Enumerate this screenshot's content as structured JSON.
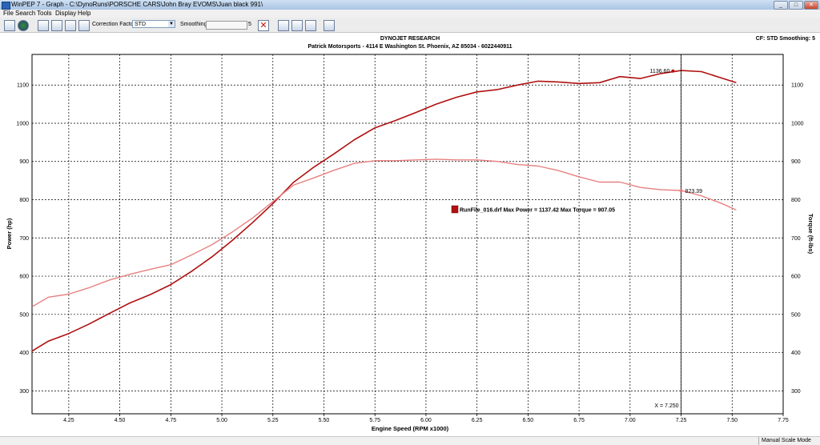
{
  "window": {
    "title": "WinPEP 7 - Graph - C:\\DynoRuns\\PORSCHE CARS\\John Bray EVOMS\\Juan black 991\\",
    "buttons": [
      "_",
      "□",
      "✕"
    ]
  },
  "menu": [
    "File",
    "Search",
    "Tools",
    "Display",
    "Help"
  ],
  "toolbar": {
    "correction_label": "Correction Factor:",
    "correction_value": "STD",
    "smoothing_label": "Smoothing:",
    "smoothing_value": "5"
  },
  "status": "Manual Scale Mode",
  "colors": {
    "power": "#b01010",
    "torque": "#e88080",
    "grid": "#000000",
    "background": "#ffffff"
  },
  "chart_data": {
    "type": "line",
    "title": "DYNOJET RESEARCH",
    "subtitle": "Patrick Motorsports - 4114 E Washington St. Phoenix, AZ 85034 - 6022440911",
    "header_right": "CF: STD  Smoothing: 5",
    "xlabel": "Engine Speed (RPM x1000)",
    "ylabel_left": "Power (hp)",
    "ylabel_right": "Torque (ft-lbs)",
    "xlim": [
      4.07,
      7.75
    ],
    "ylim": [
      240,
      1180
    ],
    "xticks": [
      4.25,
      4.5,
      4.75,
      5.0,
      5.25,
      5.5,
      5.75,
      6.0,
      6.25,
      6.5,
      6.75,
      7.0,
      7.25,
      7.5,
      7.75
    ],
    "xtick_labels": [
      "4.25",
      "4.50",
      "4.75",
      "5.00",
      "5.25",
      "5.50",
      "5.75",
      "6.00",
      "6.25",
      "6.50",
      "6.75",
      "7.00",
      "7.25",
      "7.50",
      "7.75"
    ],
    "yticks": [
      300,
      400,
      500,
      600,
      700,
      800,
      900,
      1000,
      1100
    ],
    "ytick_labels": [
      "300",
      "400",
      "500",
      "600",
      "700",
      "800",
      "900",
      "1000",
      "1100"
    ],
    "grid": true,
    "series": [
      {
        "axis": "power",
        "x": [
          4.07,
          4.15,
          4.25,
          4.35,
          4.45,
          4.55,
          4.65,
          4.75,
          4.85,
          4.95,
          5.05,
          5.15,
          5.25,
          5.35,
          5.45,
          5.55,
          5.65,
          5.75,
          5.85,
          5.95,
          6.05,
          6.15,
          6.25,
          6.35,
          6.45,
          6.55,
          6.65,
          6.75,
          6.85,
          6.95,
          7.05,
          7.15,
          7.25,
          7.35,
          7.45,
          7.52
        ],
        "values": [
          404,
          430,
          450,
          475,
          503,
          530,
          552,
          578,
          612,
          650,
          693,
          740,
          790,
          845,
          885,
          920,
          957,
          988,
          1007,
          1028,
          1050,
          1068,
          1082,
          1088,
          1100,
          1110,
          1108,
          1104,
          1106,
          1122,
          1117,
          1130,
          1138,
          1135,
          1118,
          1106
        ]
      },
      {
        "axis": "torque",
        "x": [
          4.07,
          4.15,
          4.25,
          4.35,
          4.45,
          4.55,
          4.65,
          4.75,
          4.85,
          4.95,
          5.05,
          5.15,
          5.25,
          5.35,
          5.45,
          5.55,
          5.65,
          5.75,
          5.85,
          5.95,
          6.05,
          6.15,
          6.25,
          6.35,
          6.45,
          6.55,
          6.65,
          6.75,
          6.85,
          6.95,
          7.05,
          7.15,
          7.25,
          7.35,
          7.45,
          7.52
        ],
        "values": [
          520,
          545,
          553,
          570,
          590,
          605,
          618,
          630,
          655,
          682,
          715,
          752,
          795,
          838,
          857,
          877,
          895,
          902,
          902,
          904,
          906,
          904,
          904,
          900,
          892,
          888,
          876,
          860,
          846,
          846,
          832,
          826,
          824,
          810,
          790,
          773
        ]
      }
    ],
    "annotations": {
      "peak_power_label": "1136.60",
      "peak_power_point": [
        7.21,
        1136.6
      ],
      "cursor_torque_label": "823.39",
      "cursor_torque_point": [
        7.25,
        823.39
      ],
      "cursor_x_label": "X = 7.250",
      "cursor_x": 7.25,
      "legend_text": "RunFile_016.drf Max Power = 1137.42 Max Torque = 907.05"
    }
  }
}
